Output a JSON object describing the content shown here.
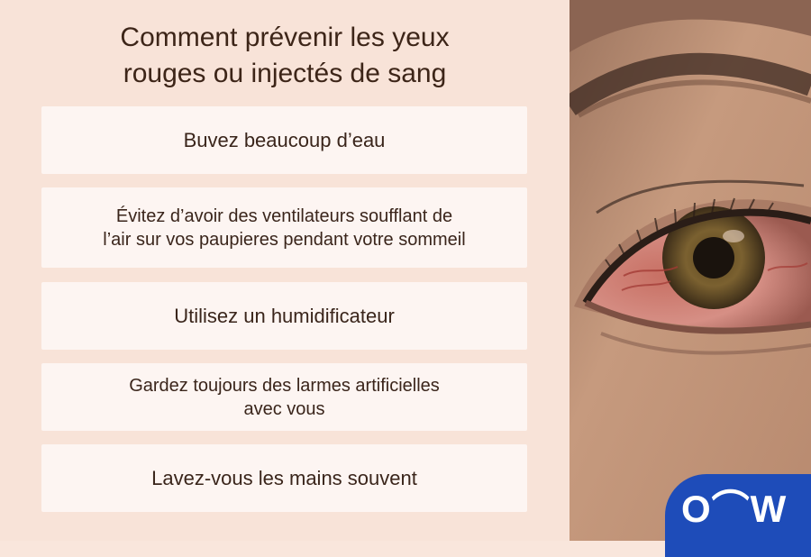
{
  "title": "Comment prévenir les yeux\nrouges ou injectés de sang",
  "tips": [
    {
      "text": "Buvez beaucoup d’eau"
    },
    {
      "text": "Évitez d’avoir des ventilateurs soufflant de\nl’air sur vos paupieres pendant votre sommeil"
    },
    {
      "text": "Utilisez un humidificateur"
    },
    {
      "text": "Gardez toujours des larmes artificielles\navec vous"
    },
    {
      "text": "Lavez-vous les mains souvent"
    }
  ],
  "logo": {
    "text": "O⌒W",
    "color": "#1e4cb9"
  },
  "colors": {
    "background": "#f9e6dc",
    "card": "#fdf5f2",
    "text": "#3a251b"
  }
}
